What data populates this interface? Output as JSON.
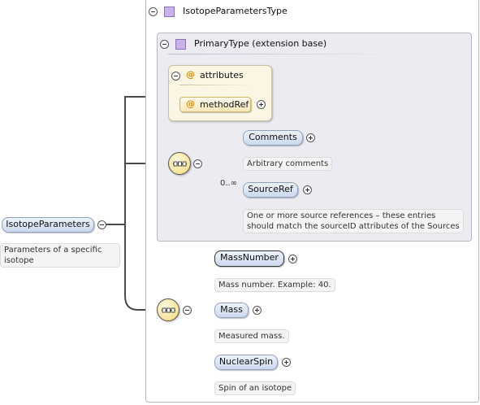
{
  "root": {
    "name": "IsotopeParameters",
    "doc": [
      "Parameters of a specific",
      "isotope"
    ]
  },
  "complex_type": {
    "name": "IsotopeParametersType"
  },
  "extension": {
    "label": "PrimaryType (extension base)"
  },
  "attributes": {
    "label": "attributes",
    "items": [
      {
        "name": "methodRef"
      }
    ]
  },
  "sequence1": {
    "elements": [
      {
        "name": "Comments",
        "doc": [
          "Arbitrary comments"
        ]
      },
      {
        "name": "SourceRef",
        "occurs": "0..∞",
        "doc": [
          "One or more source references – these entries",
          "should match the sourceID attributes of the Sources"
        ]
      }
    ]
  },
  "sequence2": {
    "elements": [
      {
        "name": "MassNumber",
        "doc": [
          "Mass number. Example: 40."
        ]
      },
      {
        "name": "Mass",
        "doc": [
          "Measured mass."
        ]
      },
      {
        "name": "NuclearSpin",
        "doc": [
          "Spin of an isotope"
        ]
      }
    ]
  },
  "icons": {
    "collapse": "minus-circle-icon",
    "expand": "plus-circle-icon",
    "type": "complex-type-square-icon",
    "attribute": "at-sign-icon",
    "sequence": "sequence-compositor-icon"
  },
  "colors": {
    "connector": "#4a4a4a",
    "element_fill": "#cbd9ee",
    "attribute_fill": "#fbe7b8",
    "type_square": "#c9b2e6",
    "compositor_fill": "#f0d878"
  }
}
